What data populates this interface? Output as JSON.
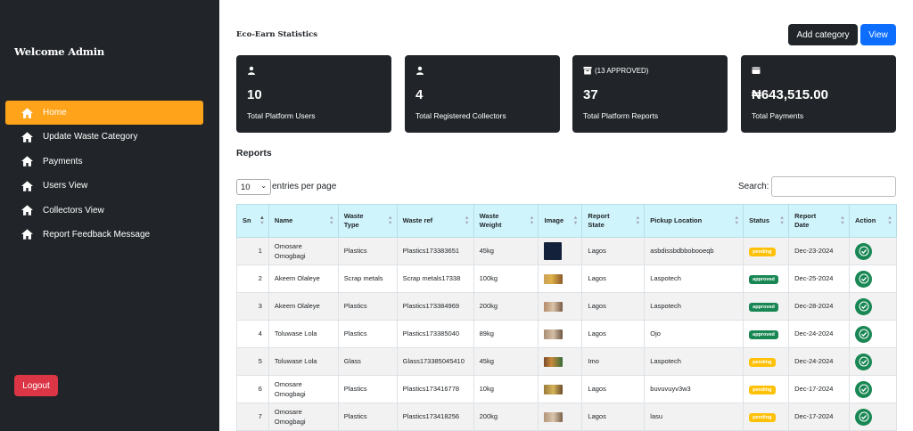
{
  "sidebar": {
    "welcome": "Welcome Admin",
    "items": [
      {
        "label": "Home",
        "icon": "home-icon",
        "active": true
      },
      {
        "label": "Update Waste Category",
        "icon": "home-icon"
      },
      {
        "label": "Payments",
        "icon": "home-icon"
      },
      {
        "label": "Users View",
        "icon": "home-icon"
      },
      {
        "label": "Collectors View",
        "icon": "home-icon"
      },
      {
        "label": "Report Feedback Message",
        "icon": "home-icon"
      }
    ],
    "logout": "Logout"
  },
  "header": {
    "title": "Eco-Earn Statistics",
    "add_category": "Add category",
    "view": "View"
  },
  "cards": [
    {
      "head": "",
      "icon": "user-icon",
      "value": "10",
      "label": "Total Platform Users"
    },
    {
      "head": "",
      "icon": "user-icon",
      "value": "4",
      "label": "Total Registered Collectors"
    },
    {
      "head": "(13 APPROVED)",
      "icon": "archive-icon",
      "value": "37",
      "label": "Total Platform Reports"
    },
    {
      "head": "",
      "icon": "wallet-icon",
      "value": "₦643,515.00",
      "label": "Total Payments"
    }
  ],
  "reports": {
    "title": "Reports",
    "page_length": "10",
    "entries_text": "entries per page",
    "search_label": "Search:",
    "columns": [
      "Sn",
      "Name",
      "Waste Type",
      "Waste ref",
      "Waste Weight",
      "Image",
      "Report State",
      "Pickup Location",
      "Status",
      "Report Date",
      "Action"
    ],
    "rows": [
      {
        "sn": "1",
        "name": "Omosare Omogbagi",
        "type": "Plastics",
        "ref": "Plastics173383651",
        "weight": "45kg",
        "state": "Lagos",
        "location": "asbdissbdbbobooeqb",
        "status": "pending",
        "date": "Dec-23-2024"
      },
      {
        "sn": "2",
        "name": "Akeem Olaleye",
        "type": "Scrap metals",
        "ref": "Scrap metals17338",
        "weight": "100kg",
        "state": "Lagos",
        "location": "Laspotech",
        "status": "approved",
        "date": "Dec-25-2024"
      },
      {
        "sn": "3",
        "name": "Akeem Olaleye",
        "type": "Plastics",
        "ref": "Plastics173384969",
        "weight": "200kg",
        "state": "Lagos",
        "location": "Laspotech",
        "status": "approved",
        "date": "Dec-28-2024"
      },
      {
        "sn": "4",
        "name": "Toluwase Lola",
        "type": "Plastics",
        "ref": "Plastics173385040",
        "weight": "89kg",
        "state": "Lagos",
        "location": "Ojo",
        "status": "approved",
        "date": "Dec-24-2024"
      },
      {
        "sn": "5",
        "name": "Toluwase Lola",
        "type": "Glass",
        "ref": "Glass173385045410",
        "weight": "45kg",
        "state": "Imo",
        "location": "Laspotech",
        "status": "pending",
        "date": "Dec-24-2024"
      },
      {
        "sn": "6",
        "name": "Omosare Omogbagi",
        "type": "Plastics",
        "ref": "Plastics173416778",
        "weight": "10kg",
        "state": "Lagos",
        "location": "buvuvuyv3w3",
        "status": "pending",
        "date": "Dec-17-2024"
      },
      {
        "sn": "7",
        "name": "Omosare Omogbagi",
        "type": "Plastics",
        "ref": "Plastics173418256",
        "weight": "200kg",
        "state": "Lagos",
        "location": "lasu",
        "status": "pending",
        "date": "Dec-17-2024"
      }
    ]
  },
  "colors": {
    "sidebar_bg": "#212529",
    "active_nav": "#ffa31a",
    "view_button": "#0d6efd",
    "logout_button": "#dc3545",
    "table_header": "#cff4fc",
    "pending_badge": "#ffc107",
    "approved_badge": "#198754"
  }
}
